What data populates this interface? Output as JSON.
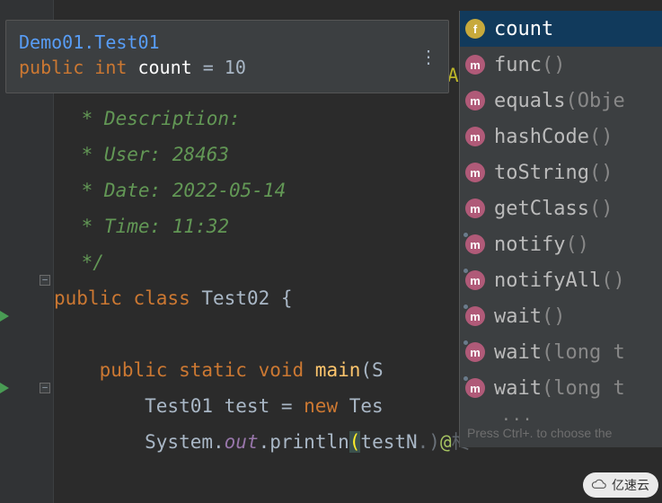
{
  "tooltip": {
    "title": "Demo01.Test01",
    "sig_prefix": "public int ",
    "sig_name": "count",
    "sig_rest": " = 10"
  },
  "at_glyph": "A",
  "code": {
    "c1": " * Description:",
    "c2": " * User: 28463",
    "c3": " * Date: 2022-05-14",
    "c4": " * Time: 11:32",
    "c5": " */",
    "class_pre": "public class ",
    "class_name": "Test02",
    "class_post": " {",
    "main_pre": "    public static void ",
    "main_name": "main",
    "main_post": "(S",
    "l1_pre": "        Test01 test = ",
    "l1_new": "new",
    "l1_post": " Tes",
    "l2_pre": "        System.",
    "l2_out": "out",
    "l2_dot": ".",
    "l2_println": "println",
    "l2_paren": "(",
    "l2_test": "test",
    "l2_n": "N",
    "l2_at": "@"
  },
  "completion": {
    "items": [
      {
        "badge": "f",
        "name": "count",
        "paren": "",
        "pin": false,
        "sel": true
      },
      {
        "badge": "m",
        "name": "func",
        "paren": "()",
        "pin": false,
        "sel": false
      },
      {
        "badge": "m",
        "name": "equals",
        "paren": "(Obje",
        "pin": false,
        "sel": false
      },
      {
        "badge": "m",
        "name": "hashCode",
        "paren": "()",
        "pin": false,
        "sel": false
      },
      {
        "badge": "m",
        "name": "toString",
        "paren": "()",
        "pin": false,
        "sel": false
      },
      {
        "badge": "m",
        "name": "getClass",
        "paren": "()",
        "pin": false,
        "sel": false
      },
      {
        "badge": "m",
        "name": "notify",
        "paren": "()",
        "pin": true,
        "sel": false
      },
      {
        "badge": "m",
        "name": "notifyAll",
        "paren": "()",
        "pin": true,
        "sel": false
      },
      {
        "badge": "m",
        "name": "wait",
        "paren": "()",
        "pin": true,
        "sel": false
      },
      {
        "badge": "m",
        "name": "wait",
        "paren": "(long t",
        "pin": true,
        "sel": false
      },
      {
        "badge": "m",
        "name": "wait",
        "paren": "(long t",
        "pin": true,
        "sel": false
      }
    ],
    "hint": "Press Ctrl+. to choose the"
  },
  "watermark": "亿速云"
}
